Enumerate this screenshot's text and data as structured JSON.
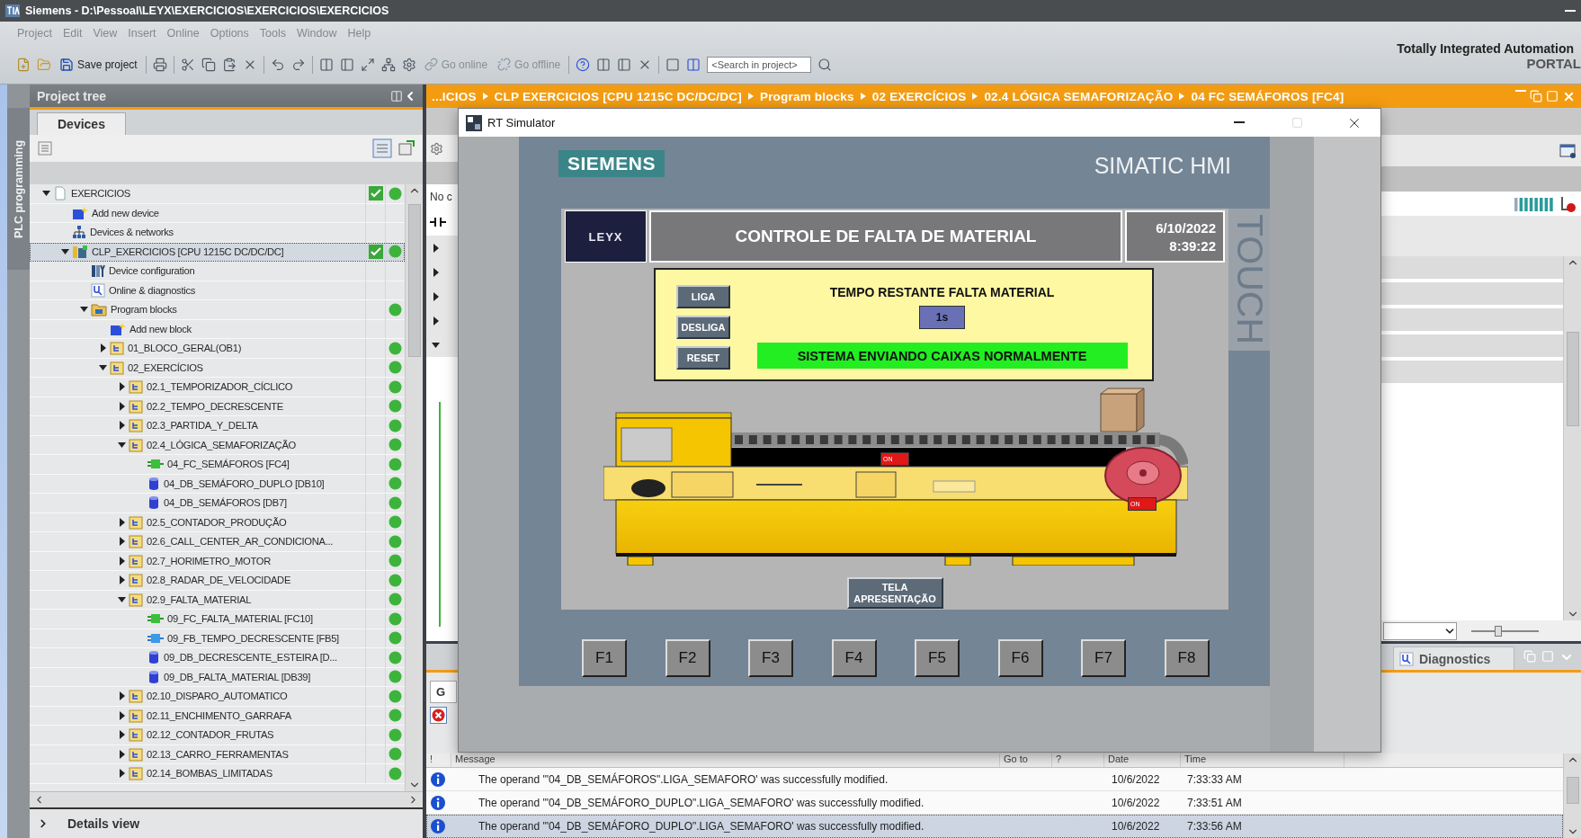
{
  "window": {
    "title": "Siemens - D:\\Pessoal\\LEYX\\EXERCICIOS\\EXERCICIOS\\EXERCICIOS"
  },
  "menu": [
    "Project",
    "Edit",
    "View",
    "Insert",
    "Online",
    "Options",
    "Tools",
    "Window",
    "Help"
  ],
  "branding": {
    "line1": "Totally Integrated Automation",
    "line2": "PORTAL"
  },
  "toolbar": {
    "save": "Save project",
    "go_online": "Go online",
    "go_offline": "Go offline",
    "search": {
      "placeholder": "<Search in project>"
    }
  },
  "side_tab": "PLC programming",
  "project_tree": {
    "title": "Project tree",
    "tab": "Devices",
    "details": "Details view",
    "items": [
      {
        "label": "EXERCICIOS",
        "kind": "project",
        "expanded": true,
        "selected": false,
        "compiled": true,
        "online_ok": true,
        "children": [
          {
            "label": "Add new device",
            "kind": "add",
            "selected": false,
            "compiled": false,
            "online_ok": false
          },
          {
            "label": "Devices & networks",
            "kind": "network",
            "selected": false,
            "compiled": false,
            "online_ok": false
          },
          {
            "label": "CLP_EXERCICIOS [CPU 1215C DC/DC/DC]",
            "kind": "plc",
            "expanded": true,
            "selected": true,
            "compiled": true,
            "online_ok": true,
            "children": [
              {
                "label": "Device configuration",
                "kind": "config",
                "selected": false,
                "compiled": false,
                "online_ok": false
              },
              {
                "label": "Online & diagnostics",
                "kind": "diag",
                "selected": false,
                "compiled": false,
                "online_ok": false
              },
              {
                "label": "Program blocks",
                "kind": "blocks",
                "expanded": true,
                "selected": false,
                "compiled": false,
                "online_ok": true,
                "children": [
                  {
                    "label": "Add new block",
                    "kind": "add",
                    "selected": false,
                    "compiled": false,
                    "online_ok": false
                  },
                  {
                    "label": "01_BLOCO_GERAL(OB1)",
                    "kind": "group",
                    "expanded": false,
                    "selected": false,
                    "compiled": false,
                    "online_ok": true
                  },
                  {
                    "label": "02_EXERCÍCIOS",
                    "kind": "group",
                    "expanded": true,
                    "selected": false,
                    "compiled": false,
                    "online_ok": true,
                    "children": [
                      {
                        "label": "02.1_TEMPORIZADOR_CÍCLICO",
                        "kind": "group",
                        "expanded": false,
                        "selected": false,
                        "compiled": false,
                        "online_ok": true
                      },
                      {
                        "label": "02.2_TEMPO_DECRESCENTE",
                        "kind": "group",
                        "expanded": false,
                        "selected": false,
                        "compiled": false,
                        "online_ok": true
                      },
                      {
                        "label": "02.3_PARTIDA_Y_DELTA",
                        "kind": "group",
                        "expanded": false,
                        "selected": false,
                        "compiled": false,
                        "online_ok": true
                      },
                      {
                        "label": "02.4_LÓGICA_SEMAFORIZAÇÃO",
                        "kind": "group",
                        "expanded": true,
                        "selected": false,
                        "compiled": false,
                        "online_ok": true,
                        "children": [
                          {
                            "label": "04_FC_SEMÁFOROS [FC4]",
                            "kind": "fc",
                            "selected": false,
                            "compiled": false,
                            "online_ok": true
                          },
                          {
                            "label": "04_DB_SEMÁFORO_DUPLO [DB10]",
                            "kind": "db",
                            "selected": false,
                            "compiled": false,
                            "online_ok": true
                          },
                          {
                            "label": "04_DB_SEMÁFOROS [DB7]",
                            "kind": "db",
                            "selected": false,
                            "compiled": false,
                            "online_ok": true
                          }
                        ]
                      },
                      {
                        "label": "02.5_CONTADOR_PRODUÇÃO",
                        "kind": "group",
                        "expanded": false,
                        "selected": false,
                        "compiled": false,
                        "online_ok": true
                      },
                      {
                        "label": "02.6_CALL_CENTER_AR_CONDICIONA...",
                        "kind": "group",
                        "expanded": false,
                        "selected": false,
                        "compiled": false,
                        "online_ok": true
                      },
                      {
                        "label": "02.7_HORIMETRO_MOTOR",
                        "kind": "group",
                        "expanded": false,
                        "selected": false,
                        "compiled": false,
                        "online_ok": true
                      },
                      {
                        "label": "02.8_RADAR_DE_VELOCIDADE",
                        "kind": "group",
                        "expanded": false,
                        "selected": false,
                        "compiled": false,
                        "online_ok": true
                      },
                      {
                        "label": "02.9_FALTA_MATERIAL",
                        "kind": "group",
                        "expanded": true,
                        "selected": false,
                        "compiled": false,
                        "online_ok": true,
                        "children": [
                          {
                            "label": "09_FC_FALTA_MATERIAL [FC10]",
                            "kind": "fc",
                            "selected": false,
                            "compiled": false,
                            "online_ok": true
                          },
                          {
                            "label": "09_FB_TEMPO_DECRESCENTE [FB5]",
                            "kind": "fb",
                            "selected": false,
                            "compiled": false,
                            "online_ok": true
                          },
                          {
                            "label": "09_DB_DECRESCENTE_ESTEIRA [D...",
                            "kind": "db",
                            "selected": false,
                            "compiled": false,
                            "online_ok": true
                          },
                          {
                            "label": "09_DB_FALTA_MATERIAL [DB39]",
                            "kind": "db",
                            "selected": false,
                            "compiled": false,
                            "online_ok": true
                          }
                        ]
                      },
                      {
                        "label": "02.10_DISPARO_AUTOMATICO",
                        "kind": "group",
                        "expanded": false,
                        "selected": false,
                        "compiled": false,
                        "online_ok": true
                      },
                      {
                        "label": "02.11_ENCHIMENTO_GARRAFA",
                        "kind": "group",
                        "expanded": false,
                        "selected": false,
                        "compiled": false,
                        "online_ok": true
                      },
                      {
                        "label": "02.12_CONTADOR_FRUTAS",
                        "kind": "group",
                        "expanded": false,
                        "selected": false,
                        "compiled": false,
                        "online_ok": true
                      },
                      {
                        "label": "02.13_CARRO_FERRAMENTAS",
                        "kind": "group",
                        "expanded": false,
                        "selected": false,
                        "compiled": false,
                        "online_ok": true
                      },
                      {
                        "label": "02.14_BOMBAS_LIMITADAS",
                        "kind": "group",
                        "expanded": false,
                        "selected": false,
                        "compiled": false,
                        "online_ok": true
                      }
                    ]
                  }
                ]
              }
            ]
          }
        ]
      }
    ]
  },
  "editor": {
    "breadcrumb": [
      "...ICIOS",
      "CLP EXERCICIOS [CPU 1215C DC/DC/DC]",
      "Program blocks",
      "02 EXERCÍCIOS",
      "02.4 LÓGICA SEMAFORIZAÇÃO",
      "04 FC SEMÁFOROS [FC4]"
    ],
    "network_label": "No c",
    "networks": [
      {
        "expanded": false
      },
      {
        "expanded": false
      },
      {
        "expanded": false
      },
      {
        "expanded": false
      },
      {
        "expanded": true
      }
    ],
    "zoom": {
      "level": 0.4
    }
  },
  "inspector": {
    "tab": "G",
    "diagnostics_tab": "Diagnostics"
  },
  "messages": {
    "columns": [
      "!",
      "Message",
      "Go to",
      "?",
      "Date",
      "Time"
    ],
    "rows": [
      {
        "kind": "info",
        "message": "The operand '\"04_DB_SEMÁFOROS\".LIGA_SEMAFORO' was successfully modified.",
        "date": "10/6/2022",
        "time": "7:33:33 AM",
        "selected": false
      },
      {
        "kind": "info",
        "message": "The operand '\"04_DB_SEMÁFORO_DUPLO\".LIGA_SEMAFORO' was successfully modified.",
        "date": "10/6/2022",
        "time": "7:33:51 AM",
        "selected": false
      },
      {
        "kind": "info",
        "message": "The operand '\"04_DB_SEMÁFORO_DUPLO\".LIGA_SEMAFORO' was successfully modified.",
        "date": "10/6/2022",
        "time": "7:33:56 AM",
        "selected": true
      }
    ]
  },
  "simulator": {
    "title": "RT Simulator",
    "brand": "SIEMENS",
    "product": "SIMATIC HMI",
    "touch": "TOUCH",
    "screen": {
      "logo": "LEYX",
      "title": "CONTROLE DE FALTA DE MATERIAL",
      "date": "6/10/2022",
      "time": "8:39:22",
      "buttons": [
        "LIGA",
        "DESLIGA",
        "RESET"
      ],
      "timer_label": "TEMPO RESTANTE FALTA MATERIAL",
      "timer_value": "1s",
      "status": "SISTEMA ENVIANDO CAIXAS NORMALMENTE",
      "switches": [
        {
          "label": "ON",
          "on": true
        },
        {
          "label": "ON",
          "on": true
        }
      ],
      "nav_button": "TELA APRESENTAÇÃO"
    },
    "function_keys": [
      "F1",
      "F2",
      "F3",
      "F4",
      "F5",
      "F6",
      "F7",
      "F8"
    ]
  }
}
